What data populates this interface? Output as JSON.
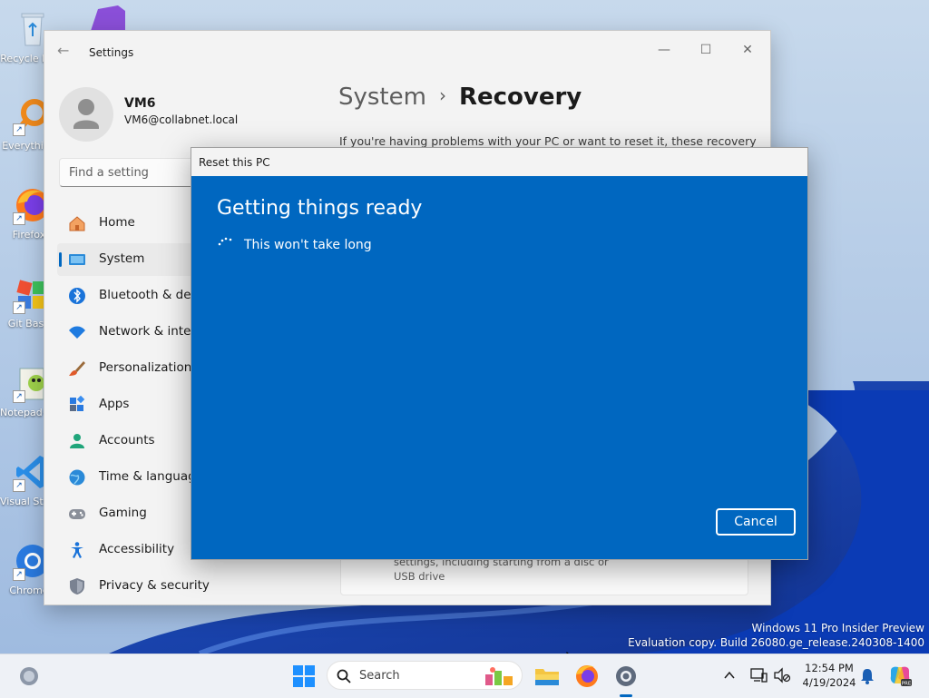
{
  "desktop": {
    "icons": [
      {
        "label": "Recycle Bin"
      },
      {
        "label": "Everything"
      },
      {
        "label": "Firefox"
      },
      {
        "label": "Git Bash"
      },
      {
        "label": "Notepad++"
      },
      {
        "label": "Visual Studio Code"
      },
      {
        "label": "Chrome"
      }
    ],
    "watermark_line1": "Windows 11 Pro Insider Preview",
    "watermark_line2": "Evaluation copy. Build 26080.ge_release.240308-1400"
  },
  "settings": {
    "app_title": "Settings",
    "user": {
      "name": "VM6",
      "email": "VM6@collabnet.local"
    },
    "search_placeholder": "Find a setting",
    "nav": [
      {
        "label": "Home",
        "icon": "home-icon"
      },
      {
        "label": "System",
        "icon": "system-icon",
        "active": true
      },
      {
        "label": "Bluetooth & devices",
        "icon": "bluetooth-icon"
      },
      {
        "label": "Network & internet",
        "icon": "wifi-icon"
      },
      {
        "label": "Personalization",
        "icon": "brush-icon"
      },
      {
        "label": "Apps",
        "icon": "apps-icon"
      },
      {
        "label": "Accounts",
        "icon": "accounts-icon"
      },
      {
        "label": "Time & language",
        "icon": "globe-icon"
      },
      {
        "label": "Gaming",
        "icon": "gamepad-icon"
      },
      {
        "label": "Accessibility",
        "icon": "accessibility-icon"
      },
      {
        "label": "Privacy & security",
        "icon": "shield-icon"
      }
    ],
    "breadcrumb": {
      "parent": "System",
      "separator": "›",
      "current": "Recovery"
    },
    "description": "If you're having problems with your PC or want to reset it, these recovery",
    "card_text": "settings, including starting from a disc or USB drive"
  },
  "reset_dialog": {
    "title": "Reset this PC",
    "heading": "Getting things ready",
    "subtext": "This won't take long",
    "cancel_label": "Cancel",
    "bg_color": "#0067c0"
  },
  "taskbar": {
    "search_label": "Search",
    "time": "12:54 PM",
    "date": "4/19/2024"
  }
}
